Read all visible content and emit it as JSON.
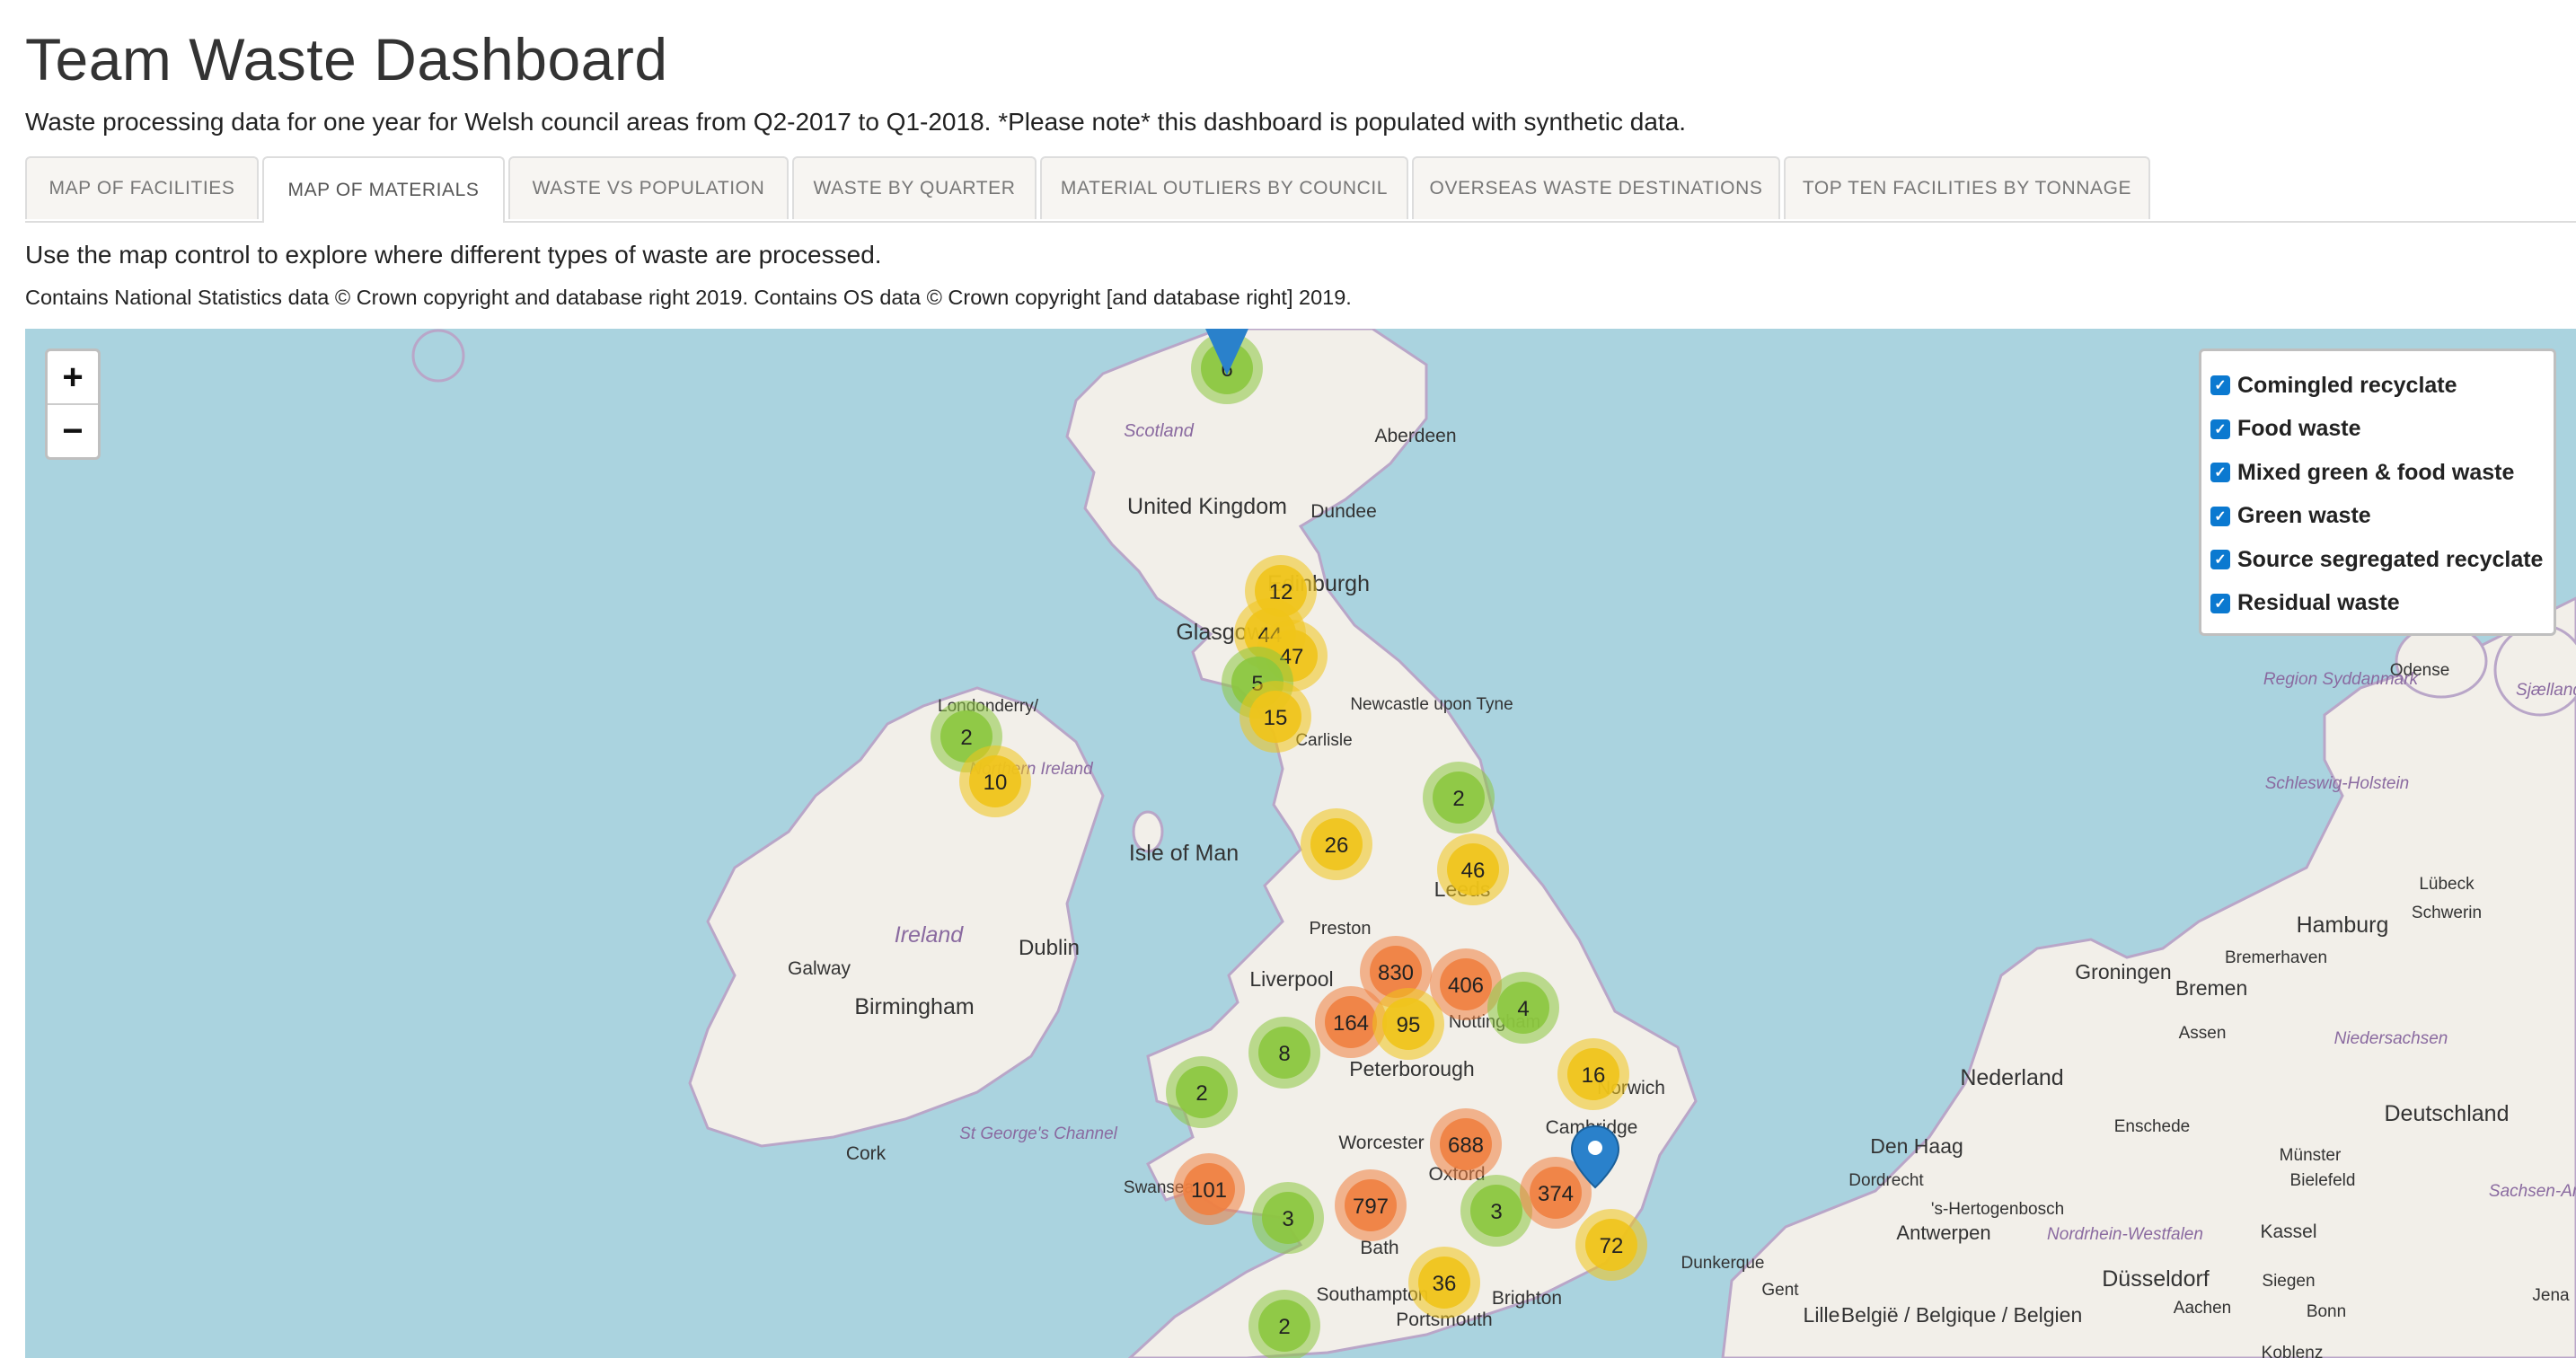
{
  "header": {
    "title": "Team Waste Dashboard",
    "subtitle": "Waste processing data for one year for Welsh council areas from Q2-2017 to Q1-2018. *Please note* this dashboard is populated with synthetic data."
  },
  "tabs": [
    {
      "label": "MAP OF FACILITIES",
      "active": false
    },
    {
      "label": "MAP OF MATERIALS",
      "active": true
    },
    {
      "label": "WASTE VS POPULATION",
      "active": false
    },
    {
      "label": "WASTE BY QUARTER",
      "active": false
    },
    {
      "label": "MATERIAL OUTLIERS BY COUNCIL",
      "active": false
    },
    {
      "label": "OVERSEAS WASTE DESTINATIONS",
      "active": false
    },
    {
      "label": "TOP TEN FACILITIES BY TONNAGE",
      "active": false
    }
  ],
  "content": {
    "instructions": "Use the map control to explore where different types of waste are processed.",
    "attribution": "Contains National Statistics data © Crown copyright and database right 2019. Contains OS data © Crown copyright [and database right] 2019."
  },
  "map": {
    "zoom_in": "+",
    "zoom_out": "−",
    "layers": [
      {
        "label": "Comingled recyclate",
        "checked": true
      },
      {
        "label": "Food waste",
        "checked": true
      },
      {
        "label": "Mixed green & food waste",
        "checked": true
      },
      {
        "label": "Green waste",
        "checked": true
      },
      {
        "label": "Source segregated recyclate",
        "checked": true
      },
      {
        "label": "Residual waste",
        "checked": true
      }
    ],
    "colors": {
      "sea": "#aad3df",
      "land": "#f2efe9",
      "small": "#8cc63f",
      "medium": "#f0c419",
      "large": "#f08040",
      "pin": "#2a81cb"
    },
    "place_labels": [
      {
        "text": "Scotland"
      },
      {
        "text": "Aberdeen"
      },
      {
        "text": "United Kingdom"
      },
      {
        "text": "Dundee"
      },
      {
        "text": "Edinburgh"
      },
      {
        "text": "Glasgow"
      },
      {
        "text": "Londonderry/"
      },
      {
        "text": "Northern Ireland"
      },
      {
        "text": "Newcastle upon Tyne"
      },
      {
        "text": "Carlisle"
      },
      {
        "text": "Isle of Man"
      },
      {
        "text": "Leeds"
      },
      {
        "text": "Preston"
      },
      {
        "text": "Liverpool"
      },
      {
        "text": "Nottingham"
      },
      {
        "text": "Ireland"
      },
      {
        "text": "Galway"
      },
      {
        "text": "Dublin"
      },
      {
        "text": "Birmingham"
      },
      {
        "text": "Peterborough"
      },
      {
        "text": "Norwich"
      },
      {
        "text": "Cambridge"
      },
      {
        "text": "Cork"
      },
      {
        "text": "St George's Channel"
      },
      {
        "text": "Worcester"
      },
      {
        "text": "Oxford"
      },
      {
        "text": "Swansea"
      },
      {
        "text": "Bath"
      },
      {
        "text": "Southampton"
      },
      {
        "text": "Portsmouth"
      },
      {
        "text": "Brighton"
      },
      {
        "text": "Dunkerque"
      },
      {
        "text": "Gent"
      },
      {
        "text": "Lille"
      },
      {
        "text": "België / Belgique / Belgien"
      },
      {
        "text": "Antwerpen"
      },
      {
        "text": "Dordrecht"
      },
      {
        "text": "'s-Hertogenbosch"
      },
      {
        "text": "Den Haag"
      },
      {
        "text": "Nederland"
      },
      {
        "text": "Groningen"
      },
      {
        "text": "Bremen"
      },
      {
        "text": "Hamburg"
      },
      {
        "text": "Schwerin"
      },
      {
        "text": "Bremerhaven"
      },
      {
        "text": "Deutschland"
      },
      {
        "text": "Düsseldorf"
      },
      {
        "text": "Münster"
      },
      {
        "text": "Bielefeld"
      },
      {
        "text": "Kassel"
      },
      {
        "text": "Aachen"
      },
      {
        "text": "Bonn"
      },
      {
        "text": "Siegen"
      },
      {
        "text": "Koblenz"
      },
      {
        "text": "Jena"
      },
      {
        "text": "Enschede"
      },
      {
        "text": "Assen"
      },
      {
        "text": "Lübeck"
      },
      {
        "text": "Odense"
      },
      {
        "text": "Sjælland"
      },
      {
        "text": "Region Syddanmark"
      },
      {
        "text": "Schleswig-Holstein"
      },
      {
        "text": "Niedersachsen"
      },
      {
        "text": "Nordrhein-Westfalen"
      },
      {
        "text": "Sachsen-Anhalt"
      }
    ],
    "clusters": [
      {
        "count": "6",
        "size": "small"
      },
      {
        "count": "12",
        "size": "medium"
      },
      {
        "count": "44",
        "size": "medium"
      },
      {
        "count": "47",
        "size": "medium"
      },
      {
        "count": "5",
        "size": "small"
      },
      {
        "count": "15",
        "size": "medium"
      },
      {
        "count": "2",
        "size": "small"
      },
      {
        "count": "10",
        "size": "medium"
      },
      {
        "count": "2",
        "size": "small"
      },
      {
        "count": "26",
        "size": "medium"
      },
      {
        "count": "46",
        "size": "medium"
      },
      {
        "count": "830",
        "size": "large"
      },
      {
        "count": "406",
        "size": "large"
      },
      {
        "count": "164",
        "size": "large"
      },
      {
        "count": "95",
        "size": "medium"
      },
      {
        "count": "4",
        "size": "small"
      },
      {
        "count": "8",
        "size": "small"
      },
      {
        "count": "2",
        "size": "small"
      },
      {
        "count": "16",
        "size": "medium"
      },
      {
        "count": "688",
        "size": "large"
      },
      {
        "count": "101",
        "size": "large"
      },
      {
        "count": "3",
        "size": "small"
      },
      {
        "count": "797",
        "size": "large"
      },
      {
        "count": "3",
        "size": "small"
      },
      {
        "count": "374",
        "size": "large"
      },
      {
        "count": "72",
        "size": "medium"
      },
      {
        "count": "36",
        "size": "medium"
      },
      {
        "count": "2",
        "size": "small"
      }
    ]
  }
}
